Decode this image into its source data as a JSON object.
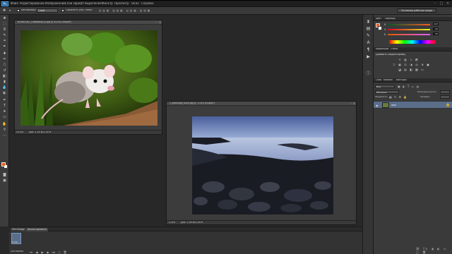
{
  "menu": {
    "logo": "Ps",
    "items": [
      "Файл",
      "Редактирование",
      "Изображение",
      "Слои",
      "Шрифт",
      "Выделение",
      "Фильтр",
      "Просмотр",
      "Окно",
      "Справка"
    ]
  },
  "options": {
    "autoselect": "Автовыбор:",
    "autoselect_value": "Слой",
    "transform_controls": "Показать упр. элем."
  },
  "workspace_label": "Основная рабочая среда",
  "doc1": {
    "title": "8OYAH1N2_1UNIbeb4d_b.jpg @ 55,4% (RGB/8*)",
    "zoom": "55,4%",
    "info": "Док: 1,16 M/1,16 M"
  },
  "doc2": {
    "title": "1_seascape_dusk.jpg @ 72,6% (RGB/8*)",
    "zoom": "72,6%",
    "info": "Док: 1,36 M/1,36 M"
  },
  "color_panel": {
    "tabs": [
      "Цвет",
      "Образцы"
    ],
    "channels": [
      {
        "label": "R",
        "value": "227"
      },
      {
        "label": "G",
        "value": "92"
      },
      {
        "label": "B",
        "value": "35"
      }
    ]
  },
  "adjustments_panel": {
    "tabs": [
      "Коррекция",
      "Стили"
    ],
    "heading": "Добавить корректировку"
  },
  "layers_panel": {
    "tabs": [
      "Слои",
      "Каналы",
      "Контуры"
    ],
    "kind": "Вид",
    "blend": "Обычные",
    "opacity_label": "Непрозрачность:",
    "lock_label": "Закрепить:",
    "fill_label": "Заливка:",
    "layer_name": "Фон"
  },
  "timeline": {
    "tabs": [
      "Mini Bridge",
      "Шкала времени"
    ],
    "frame_label": "0 сек.",
    "loop": "Постоянно"
  },
  "colors": {
    "foreground": "#e25a1c",
    "background": "#ffffff",
    "selection": "#5a6e8a"
  }
}
